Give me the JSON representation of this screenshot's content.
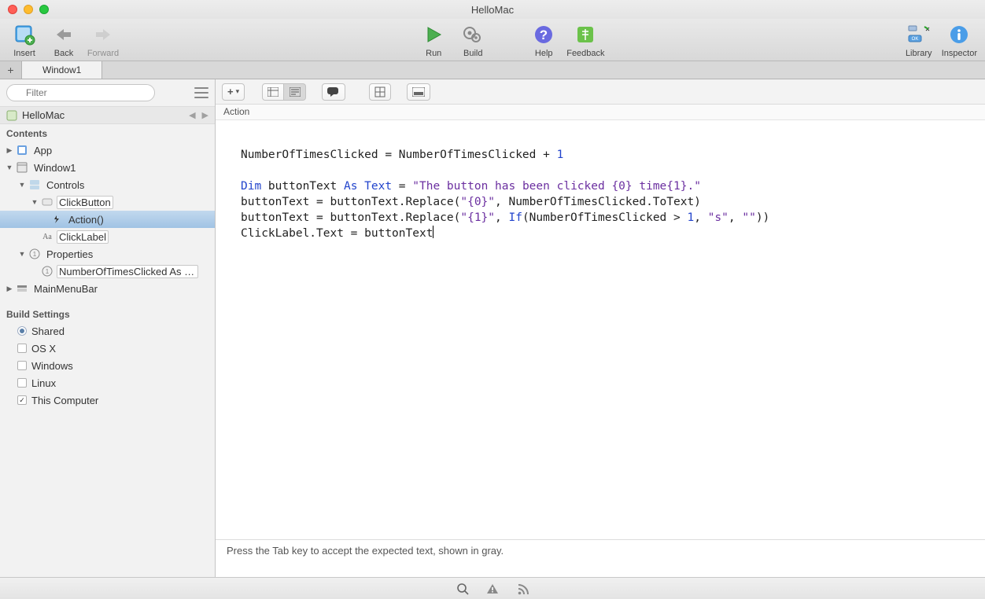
{
  "window": {
    "title": "HelloMac"
  },
  "toolbar": {
    "insert": "Insert",
    "back": "Back",
    "forward": "Forward",
    "run": "Run",
    "build": "Build",
    "help": "Help",
    "feedback": "Feedback",
    "library": "Library",
    "inspector": "Inspector"
  },
  "tabs": {
    "active": "Window1"
  },
  "sidebar": {
    "filter_placeholder": "Filter",
    "project": "HelloMac",
    "contents_header": "Contents",
    "items": {
      "app": "App",
      "window1": "Window1",
      "controls": "Controls",
      "clickbutton": "ClickButton",
      "action": "Action()",
      "clicklabel": "ClickLabel",
      "properties": "Properties",
      "numtimes": "NumberOfTimesClicked As In...",
      "mainmenubar": "MainMenuBar"
    },
    "build_header": "Build Settings",
    "build": {
      "shared": "Shared",
      "osx": "OS X",
      "windows": "Windows",
      "linux": "Linux",
      "thiscomputer": "This Computer"
    }
  },
  "editor": {
    "breadcrumb": "Action",
    "code": {
      "l1a": "NumberOfTimesClicked = NumberOfTimesClicked + ",
      "l1n": "1",
      "l3a": "Dim",
      "l3b": " buttonText ",
      "l3c": "As Text",
      "l3d": " = ",
      "l3s": "\"The button has been clicked {0} time{1}.\"",
      "l4a": "buttonText = buttonText.Replace(",
      "l4s": "\"{0}\"",
      "l4b": ", NumberOfTimesClicked.ToText)",
      "l5a": "buttonText = buttonText.Replace(",
      "l5s": "\"{1}\"",
      "l5b": ", ",
      "l5c": "If",
      "l5d": "(NumberOfTimesClicked > ",
      "l5n": "1",
      "l5e": ", ",
      "l5s2": "\"s\"",
      "l5f": ", ",
      "l5s3": "\"\"",
      "l5g": "))",
      "l6a": "ClickLabel.Text = buttonText"
    },
    "tip": "Press the Tab key to accept the expected text, shown in gray."
  }
}
